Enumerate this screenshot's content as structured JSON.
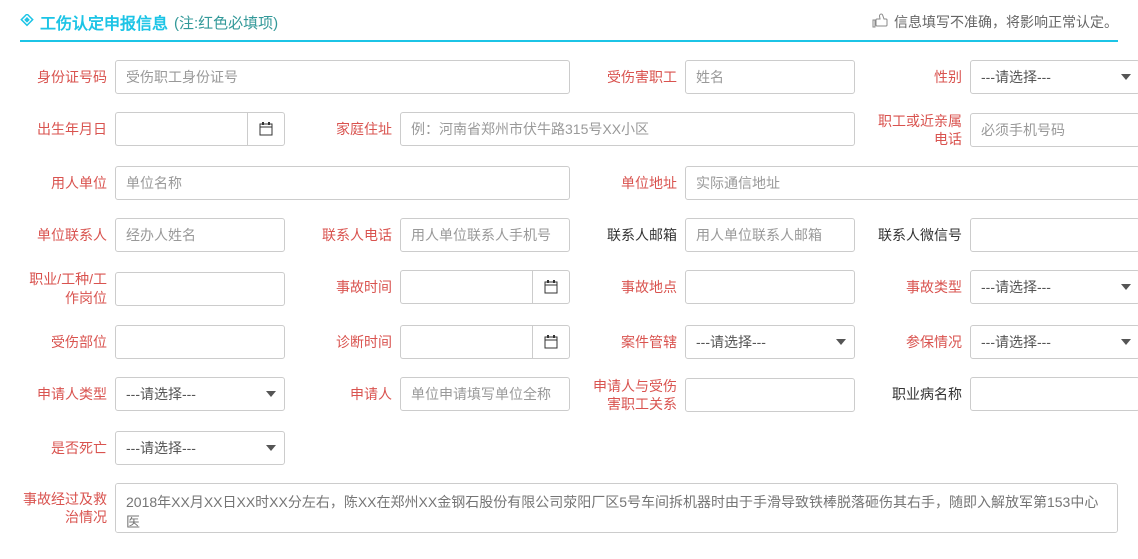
{
  "header": {
    "title": "工伤认定申报信息",
    "note": "(注:红色必填项)",
    "warning": "信息填写不准确，将影响正常认定。"
  },
  "labels": {
    "idcard": "身份证号码",
    "victim": "受伤害职工",
    "gender": "性别",
    "birth": "出生年月日",
    "homeaddr": "家庭住址",
    "relphone": "职工或近亲属电话",
    "employer": "用人单位",
    "empaddr": "单位地址",
    "empcontact": "单位联系人",
    "contactphone": "联系人电话",
    "contactemail": "联系人邮箱",
    "contactwechat": "联系人微信号",
    "job": "职业/工种/工作岗位",
    "acctime": "事故时间",
    "accplace": "事故地点",
    "acctype": "事故类型",
    "injurypart": "受伤部位",
    "diagtime": "诊断时间",
    "casejur": "案件管辖",
    "insure": "参保情况",
    "apptype": "申请人类型",
    "applicant": "申请人",
    "apprel": "申请人与受伤害职工关系",
    "occname": "职业病名称",
    "isdeath": "是否死亡",
    "accdesc": "事故经过及救治情况"
  },
  "placeholders": {
    "idcard": "受伤职工身份证号",
    "victim": "姓名",
    "homeaddr": "例：河南省郑州市伏牛路315号XX小区",
    "relphone": "必须手机号码",
    "employer": "单位名称",
    "empaddr": "实际通信地址",
    "empcontact": "经办人姓名",
    "contactphone": "用人单位联系人手机号",
    "contactemail": "用人单位联系人邮箱",
    "applicant": "单位申请填写单位全称",
    "accdesc": "2018年XX月XX日XX时XX分左右，陈XX在郑州XX金钢石股份有限公司荥阳厂区5号车间拆机器时由于手滑导致铁棒脱落砸伤其右手，随即入解放军第153中心医",
    "select": "---请选择---"
  }
}
